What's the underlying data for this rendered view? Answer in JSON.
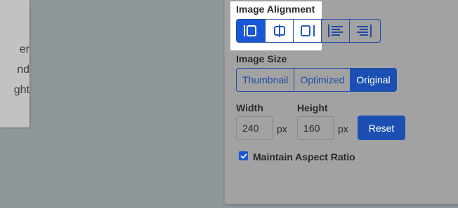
{
  "document": {
    "lines": [
      "er",
      "nd",
      "ght"
    ]
  },
  "image_alignment": {
    "label": "Image Alignment",
    "buttons": [
      {
        "icon": "align-none-icon",
        "active": true
      },
      {
        "icon": "align-center-icon",
        "active": false
      },
      {
        "icon": "align-right-icon",
        "active": false
      },
      {
        "icon": "wrap-left-icon",
        "active": false
      },
      {
        "icon": "wrap-right-icon",
        "active": false
      }
    ]
  },
  "image_size": {
    "label": "Image Size",
    "options": [
      "Thumbnail",
      "Optimized",
      "Original"
    ],
    "selected": "Original"
  },
  "dimensions": {
    "width_label": "Width",
    "width_value": "240",
    "height_label": "Height",
    "height_value": "160",
    "unit": "px",
    "reset_label": "Reset"
  },
  "aspect_ratio": {
    "label": "Maintain Aspect Ratio",
    "checked": true
  },
  "colors": {
    "accent": "#1a57d6",
    "overlay": "#8f979b"
  }
}
